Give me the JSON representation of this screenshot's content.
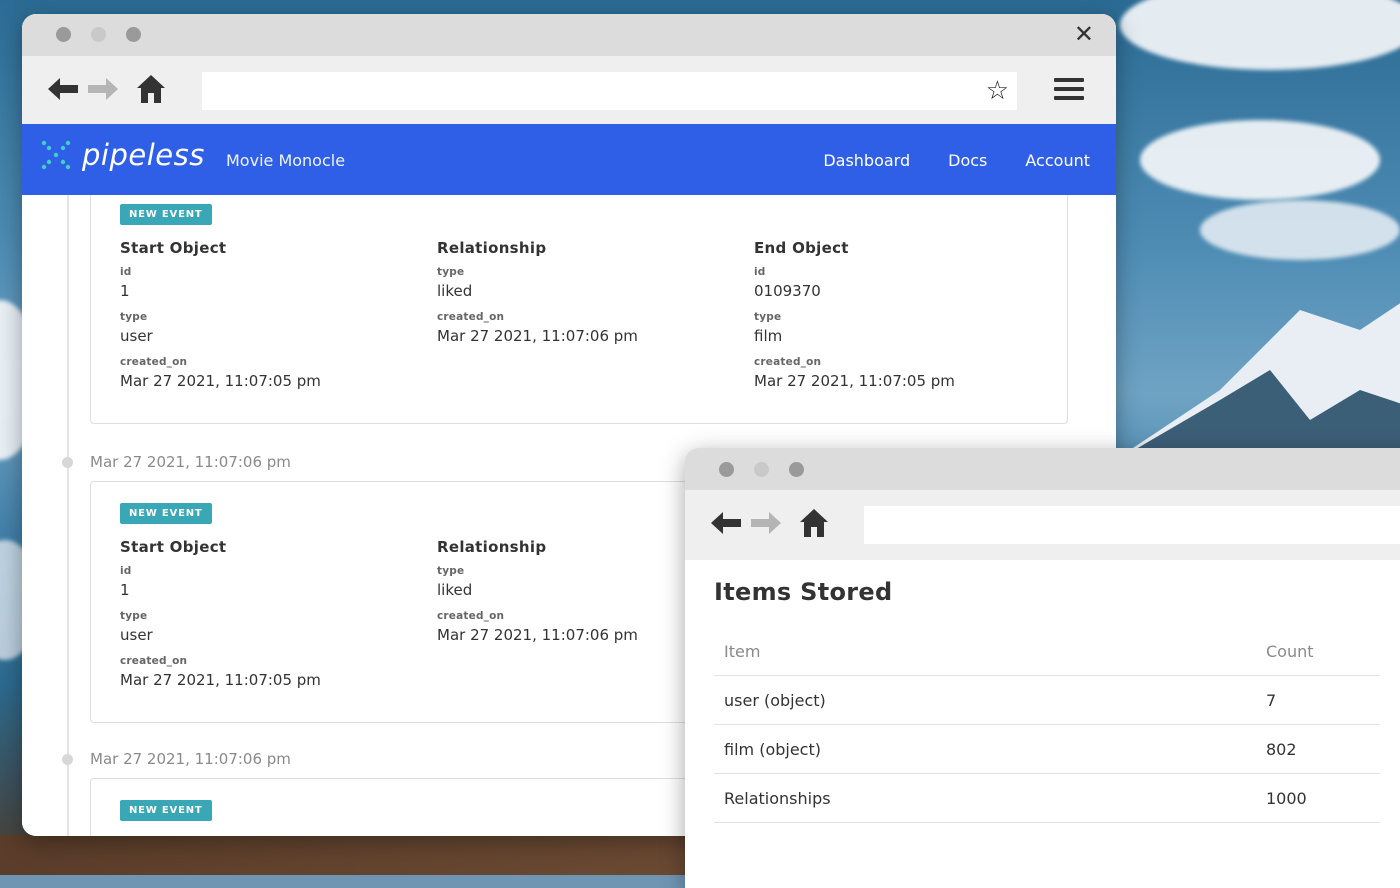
{
  "colors": {
    "brand_blue": "#2f5fe6",
    "badge_teal": "#3aa7b6"
  },
  "main_window": {
    "icons": [
      "back-arrow-icon",
      "forward-arrow-icon",
      "home-icon",
      "star-icon",
      "hamburger-menu-icon",
      "close-icon"
    ],
    "url": ""
  },
  "app": {
    "logo_text": "pipeless",
    "project": "Movie Monocle",
    "nav": [
      "Dashboard",
      "Docs",
      "Account"
    ]
  },
  "events": [
    {
      "timestamp": "",
      "badge": "NEW EVENT",
      "start": {
        "heading": "Start Object",
        "id_label": "id",
        "id": "1",
        "type_label": "type",
        "type": "user",
        "created_label": "created_on",
        "created_on": "Mar 27 2021, 11:07:05 pm"
      },
      "rel": {
        "heading": "Relationship",
        "type_label": "type",
        "type": "liked",
        "created_label": "created_on",
        "created_on": "Mar 27 2021, 11:07:06 pm"
      },
      "end": {
        "heading": "End Object",
        "id_label": "id",
        "id": "0109370",
        "type_label": "type",
        "type": "film",
        "created_label": "created_on",
        "created_on": "Mar 27 2021, 11:07:05 pm"
      }
    },
    {
      "timestamp": "Mar 27 2021, 11:07:06 pm",
      "badge": "NEW EVENT",
      "start": {
        "heading": "Start Object",
        "id_label": "id",
        "id": "1",
        "type_label": "type",
        "type": "user",
        "created_label": "created_on",
        "created_on": "Mar 27 2021, 11:07:05 pm"
      },
      "rel": {
        "heading": "Relationship",
        "type_label": "type",
        "type": "liked",
        "created_label": "created_on",
        "created_on": "Mar 27 2021, 11:07:06 pm"
      }
    },
    {
      "timestamp": "Mar 27 2021, 11:07:06 pm",
      "badge": "NEW EVENT"
    }
  ],
  "items_window": {
    "url": "",
    "title": "Items Stored",
    "columns": [
      "Item",
      "Count"
    ],
    "rows": [
      {
        "item": "user (object)",
        "count": "7"
      },
      {
        "item": "film (object)",
        "count": "802"
      },
      {
        "item": "Relationships",
        "count": "1000"
      }
    ]
  }
}
